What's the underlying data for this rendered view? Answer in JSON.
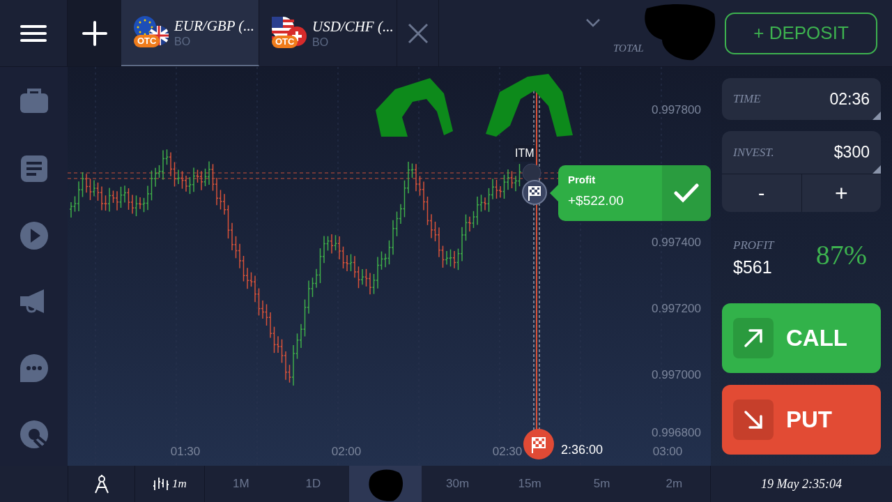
{
  "top_bar": {
    "tabs": [
      {
        "pair": "EUR/GBP (...",
        "badge": "OTC",
        "type": "BO",
        "selected": true
      },
      {
        "pair": "USD/CHF (...",
        "badge": "OTC",
        "type": "BO",
        "selected": false
      }
    ],
    "total_label": "TOTAL",
    "deposit_button": "+ DEPOSIT"
  },
  "chart": {
    "price_ticks": [
      "0.997800",
      "0.997400",
      "0.997200",
      "0.997000",
      "0.996800"
    ],
    "time_ticks": [
      "01:30",
      "02:00",
      "02:30",
      "03:00"
    ],
    "marker_label": "ITM",
    "expiry_time": "2:36:00",
    "profit_popup": {
      "title": "Profit",
      "amount": "+$522.00"
    }
  },
  "trade_panel": {
    "time_label": "TIME",
    "time_value": "02:36",
    "invest_label": "INVEST.",
    "invest_value": "$300",
    "minus": "-",
    "plus": "+",
    "profit_label": "PROFIT",
    "profit_value": "$561",
    "profit_percent": "87%",
    "call": "CALL",
    "put": "PUT"
  },
  "bottom_bar": {
    "chart_interval": "1m",
    "timeframes": [
      {
        "label": "1M",
        "selected": false
      },
      {
        "label": "1D",
        "selected": false
      },
      {
        "selected": true
      },
      {
        "label": "30m",
        "selected": false
      },
      {
        "label": "15m",
        "selected": false
      },
      {
        "label": "5m",
        "selected": false
      },
      {
        "label": "2m",
        "selected": false
      }
    ],
    "datetime": "19 May 2:35:04"
  }
}
